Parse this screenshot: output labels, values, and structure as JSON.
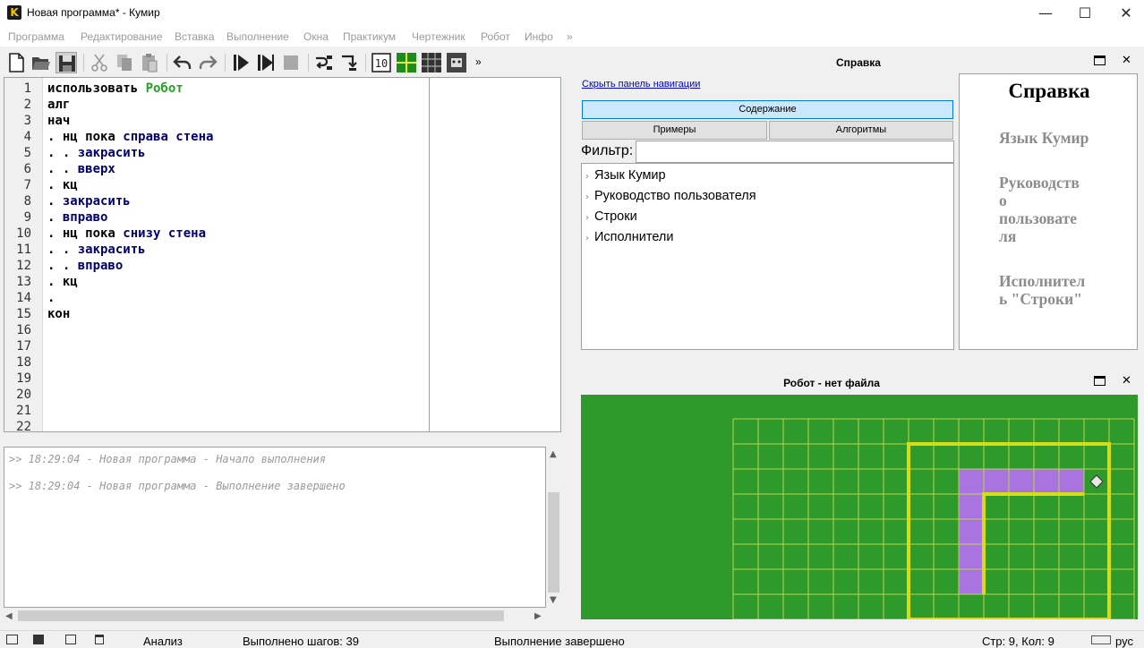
{
  "window": {
    "title": "Новая программа* - Кумир",
    "icon_letter": "K",
    "minimize": "—",
    "maximize": "☐",
    "close": "✕"
  },
  "menu": [
    "Программа",
    "Редактирование",
    "Вставка",
    "Выполнение",
    "Окна",
    "Практикум",
    "Чертежник",
    "Робот",
    "Инфо",
    "»"
  ],
  "toolbar": {
    "overflow": "»",
    "buttons": [
      "new-file",
      "open-file",
      "save-file",
      "cut",
      "copy",
      "paste",
      "undo",
      "redo",
      "run",
      "run-step",
      "stop",
      "step-over",
      "step-into",
      "show-10",
      "grid-green",
      "grid-dark",
      "robot-window"
    ],
    "counter_label": "10"
  },
  "editor": {
    "line_numbers": [
      "1",
      "2",
      "3",
      "4",
      "5",
      "6",
      "7",
      "8",
      "9",
      "10",
      "11",
      "12",
      "13",
      "14",
      "15",
      "16",
      "17",
      "18",
      "19",
      "20",
      "21",
      "22"
    ],
    "lines": [
      [
        {
          "t": "использовать ",
          "c": "#000000"
        },
        {
          "t": "Робот",
          "c": "#22a322"
        }
      ],
      [
        {
          "t": "алг",
          "c": "#000000"
        }
      ],
      [
        {
          "t": "нач",
          "c": "#000000"
        }
      ],
      [
        {
          "t": ". нц пока ",
          "c": "#000000"
        },
        {
          "t": "справа стена",
          "c": "#00006e"
        }
      ],
      [
        {
          "t": ". . ",
          "c": "#000000"
        },
        {
          "t": "закрасить",
          "c": "#00006e"
        }
      ],
      [
        {
          "t": ". . ",
          "c": "#000000"
        },
        {
          "t": "вверх",
          "c": "#00006e"
        }
      ],
      [
        {
          "t": ". кц",
          "c": "#000000"
        }
      ],
      [
        {
          "t": ". ",
          "c": "#000000"
        },
        {
          "t": "закрасить",
          "c": "#00006e"
        }
      ],
      [
        {
          "t": ". ",
          "c": "#000000"
        },
        {
          "t": "вправо",
          "c": "#00006e"
        }
      ],
      [
        {
          "t": ". нц пока ",
          "c": "#000000"
        },
        {
          "t": "снизу стена",
          "c": "#00006e"
        }
      ],
      [
        {
          "t": ". . ",
          "c": "#000000"
        },
        {
          "t": "закрасить",
          "c": "#00006e"
        }
      ],
      [
        {
          "t": ". . ",
          "c": "#000000"
        },
        {
          "t": "вправо",
          "c": "#00006e"
        }
      ],
      [
        {
          "t": ". кц",
          "c": "#000000"
        }
      ],
      [
        {
          "t": ".",
          "c": "#000000"
        }
      ],
      [
        {
          "t": "кон",
          "c": "#000000"
        }
      ]
    ]
  },
  "console": {
    "lines": [
      ">> 18:29:04 - Новая программа - Начало выполнения",
      ">> 18:29:04 - Новая программа - Выполнение завершено"
    ],
    "arrow_up": "▲",
    "arrow_down": "▼",
    "arrow_left": "◀",
    "arrow_right": "▶"
  },
  "status": {
    "analysis": "Анализ",
    "steps": "Выполнено шагов: 39",
    "state": "Выполнение завершено",
    "position": "Стр: 9, Кол: 9",
    "lang": "рус"
  },
  "help": {
    "panel_title": "Справка",
    "hide_nav": "Скрыть панель навигации",
    "tab_contents": "Содержание",
    "tab_examples": "Примеры",
    "tab_algorithms": "Алгоритмы",
    "filter_label": "Фильтр:",
    "filter_value": "",
    "toc": [
      "Язык Кумир",
      "Руководство пользователя",
      "Строки",
      "Исполнители"
    ],
    "page_heading": "Справка",
    "page_links": [
      "Язык Кумир",
      "Руководство пользователя",
      "Исполнитель \"Строки\""
    ],
    "page_link_lines": [
      [
        "Язык Кумир"
      ],
      [
        "Руководств",
        "о",
        "пользовате",
        "ля"
      ],
      [
        "Исполнител",
        "ь \"Строки\""
      ]
    ]
  },
  "robot": {
    "panel_title": "Робот - нет файла",
    "colors": {
      "field": "#2e9a2b",
      "grid": "#b9d64a",
      "wall": "#d8dc14",
      "paint": "#a974e0",
      "robot": "#e8e8e8"
    }
  }
}
